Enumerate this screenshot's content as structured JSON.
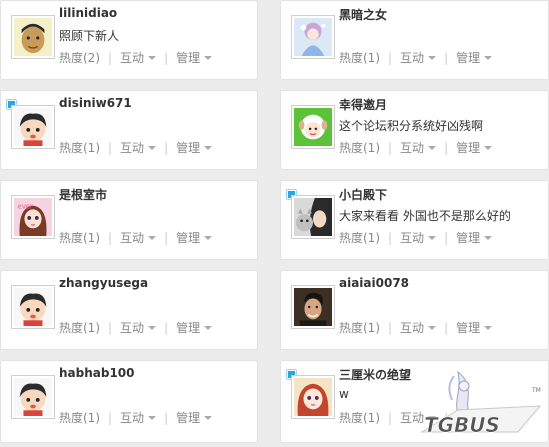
{
  "users": [
    {
      "name": "lilinidiao",
      "status": "照顾下新人",
      "online": false,
      "heat": "热度(2)",
      "interact": "互动",
      "manage": "管理",
      "avatar": "cartoon-boy-avatar"
    },
    {
      "name": "黑暗之女",
      "status": "",
      "online": false,
      "heat": "热度(1)",
      "interact": "互动",
      "manage": "管理",
      "avatar": "anime-girl-avatar"
    },
    {
      "name": "disiniw671",
      "status": "",
      "online": true,
      "heat": "热度(1)",
      "interact": "互动",
      "manage": "管理",
      "avatar": "default-cartoon-avatar"
    },
    {
      "name": "幸得邀月",
      "status": "这个论坛积分系统好凶残啊",
      "online": false,
      "heat": "热度(1)",
      "interact": "互动",
      "manage": "管理",
      "avatar": "sheep-avatar"
    },
    {
      "name": "是根室市",
      "status": "",
      "online": false,
      "heat": "热度(1)",
      "interact": "互动",
      "manage": "管理",
      "avatar": "doll-girl-avatar"
    },
    {
      "name": "小白殿下",
      "status": "大家来看看 外国也不是那么好的",
      "online": true,
      "heat": "热度(1)",
      "interact": "互动",
      "manage": "管理",
      "avatar": "photo-girl-cat-avatar"
    },
    {
      "name": "zhangyusega",
      "status": "",
      "online": false,
      "heat": "热度(1)",
      "interact": "互动",
      "manage": "管理",
      "avatar": "default-cartoon-avatar"
    },
    {
      "name": "aiaiai0078",
      "status": "",
      "online": false,
      "heat": "热度(1)",
      "interact": "互动",
      "manage": "管理",
      "avatar": "photo-man-avatar"
    },
    {
      "name": "habhab100",
      "status": "",
      "online": false,
      "heat": "热度(1)",
      "interact": "互动",
      "manage": "管理",
      "avatar": "default-cartoon-avatar"
    },
    {
      "name": "三厘米の绝望",
      "status": "w",
      "online": true,
      "heat": "热度(1)",
      "interact": "互动",
      "manage": "管理",
      "avatar": "anime-redhair-avatar"
    }
  ],
  "watermark": "TGBUS"
}
